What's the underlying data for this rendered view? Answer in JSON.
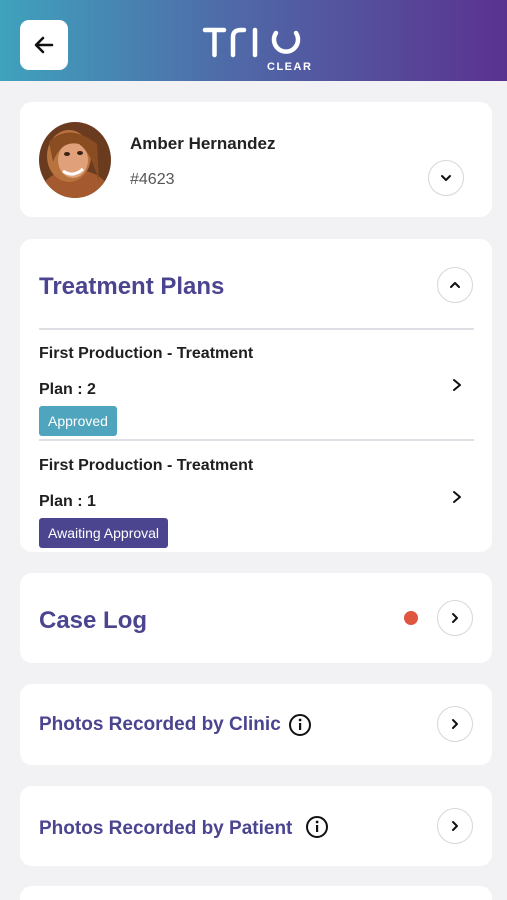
{
  "header": {
    "logo_main": "TRIO",
    "logo_sub": "CLEAR",
    "back_icon": "arrow-left-icon",
    "colors": {
      "gradient_start": "#3fa2bd",
      "gradient_end": "#5b3290"
    }
  },
  "patient": {
    "name": "Amber Hernandez",
    "id": "#4623",
    "expand_icon": "chevron-down-icon"
  },
  "treatment_plans": {
    "title": "Treatment Plans",
    "collapse_icon": "chevron-up-icon",
    "plans": [
      {
        "title": "First Production - Treatment",
        "plan": "Plan : 2",
        "status": "Approved",
        "status_color": "#4fa5bd"
      },
      {
        "title": "First Production - Treatment",
        "plan": "Plan : 1",
        "status": "Awaiting Approval",
        "status_color": "#4b4590"
      }
    ]
  },
  "case_log": {
    "title": "Case Log",
    "notification_color": "#e05540"
  },
  "photos_clinic": {
    "title": "Photos Recorded by Clinic",
    "icon": "info-icon"
  },
  "photos_patient": {
    "title": "Photos Recorded by Patient",
    "icon": "info-icon"
  },
  "accent_color": "#4b4590"
}
